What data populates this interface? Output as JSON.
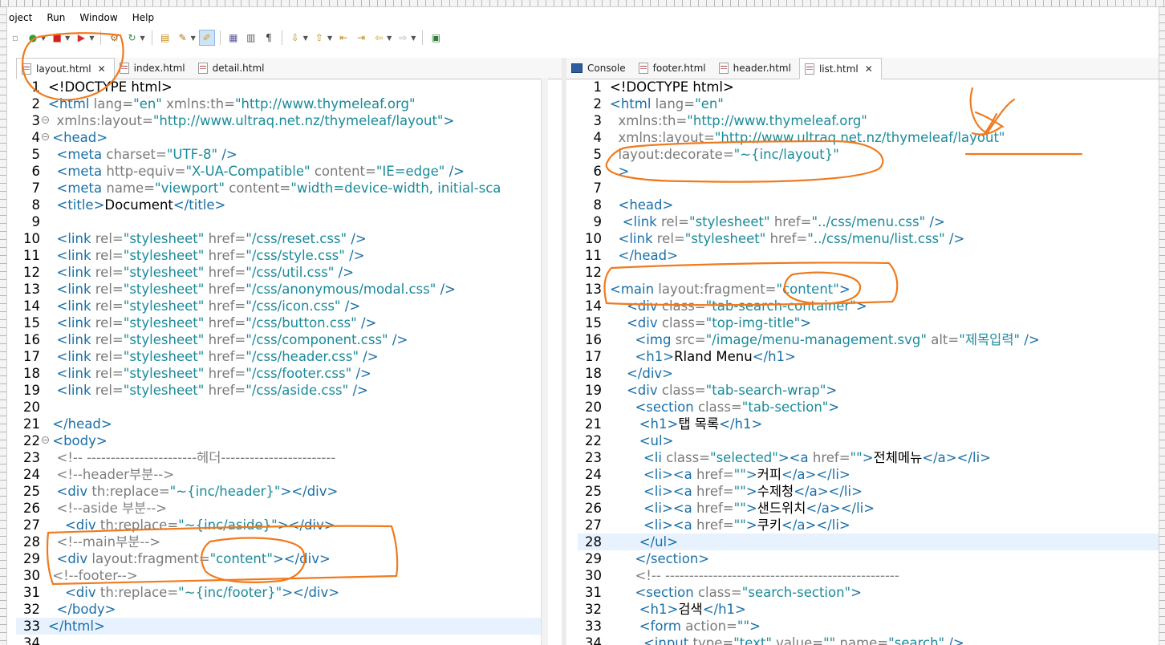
{
  "menu": [
    "oject",
    "Run",
    "Window",
    "Help"
  ],
  "toolbar_icons": [
    "new-icon",
    "run-icon",
    "stop-icon",
    "debug-icon",
    "build-icon",
    "refresh-icon",
    "open-icon",
    "tools-icon",
    "highlight-icon",
    "outline-icon",
    "properties-icon",
    "pilcrow-icon",
    "next-annotation-icon",
    "prev-annotation-icon",
    "forward-icon",
    "back-icon",
    "navigate-back-icon",
    "navigate-forward-icon",
    "maximize-icon"
  ],
  "left_tabs": [
    {
      "label": "layout.html",
      "active": true,
      "close": "✕"
    },
    {
      "label": "index.html",
      "active": false
    },
    {
      "label": "detail.html",
      "active": false
    }
  ],
  "right_tabs": [
    {
      "label": "Console",
      "active": false
    },
    {
      "label": "footer.html",
      "active": false
    },
    {
      "label": "header.html",
      "active": false
    },
    {
      "label": "list.html",
      "active": true,
      "close": "✕"
    }
  ],
  "left_code": [
    {
      "n": "1",
      "s": [
        [
          "t-doc",
          "<!DOCTYPE html>"
        ]
      ]
    },
    {
      "n": "2",
      "s": [
        [
          "t-tag",
          "<html "
        ],
        [
          "t-attr",
          "lang="
        ],
        [
          "t-str",
          "\"en\" "
        ],
        [
          "t-attr",
          "xmlns:th="
        ],
        [
          "t-str",
          "\"http://www.thymeleaf.org\""
        ]
      ]
    },
    {
      "n": "3",
      "f": "−",
      "s": [
        [
          "t-attr",
          "  xmlns:layout="
        ],
        [
          "t-str",
          "\"http://www.ultraq.net.nz/thymeleaf/layout\""
        ],
        [
          "t-tag",
          ">"
        ]
      ]
    },
    {
      "n": "4",
      "f": "−",
      "s": [
        [
          "t-tag",
          " <head>"
        ]
      ]
    },
    {
      "n": "5",
      "s": [
        [
          "t-tag",
          "  <meta "
        ],
        [
          "t-attr",
          "charset="
        ],
        [
          "t-str",
          "\"UTF-8\" "
        ],
        [
          "t-tag",
          "/>"
        ]
      ]
    },
    {
      "n": "6",
      "s": [
        [
          "t-tag",
          "  <meta "
        ],
        [
          "t-attr",
          "http-equiv="
        ],
        [
          "t-str",
          "\"X-UA-Compatible\" "
        ],
        [
          "t-attr",
          "content="
        ],
        [
          "t-str",
          "\"IE=edge\" "
        ],
        [
          "t-tag",
          "/>"
        ]
      ]
    },
    {
      "n": "7",
      "s": [
        [
          "t-tag",
          "  <meta "
        ],
        [
          "t-attr",
          "name="
        ],
        [
          "t-str",
          "\"viewport\" "
        ],
        [
          "t-attr",
          "content="
        ],
        [
          "t-str",
          "\"width=device-width, initial-sca"
        ]
      ]
    },
    {
      "n": "8",
      "s": [
        [
          "t-tag",
          "  <title>"
        ],
        [
          "t-doc",
          "Document"
        ],
        [
          "t-tag",
          "</title>"
        ]
      ]
    },
    {
      "n": "9",
      "s": []
    },
    {
      "n": "10",
      "s": [
        [
          "t-tag",
          "  <link "
        ],
        [
          "t-attr",
          "rel="
        ],
        [
          "t-str",
          "\"stylesheet\" "
        ],
        [
          "t-attr",
          "href="
        ],
        [
          "t-str",
          "\"/css/reset.css\" "
        ],
        [
          "t-tag",
          "/>"
        ]
      ]
    },
    {
      "n": "11",
      "s": [
        [
          "t-tag",
          "  <link "
        ],
        [
          "t-attr",
          "rel="
        ],
        [
          "t-str",
          "\"stylesheet\" "
        ],
        [
          "t-attr",
          "href="
        ],
        [
          "t-str",
          "\"/css/style.css\" "
        ],
        [
          "t-tag",
          "/>"
        ]
      ]
    },
    {
      "n": "12",
      "s": [
        [
          "t-tag",
          "  <link "
        ],
        [
          "t-attr",
          "rel="
        ],
        [
          "t-str",
          "\"stylesheet\" "
        ],
        [
          "t-attr",
          "href="
        ],
        [
          "t-str",
          "\"/css/util.css\" "
        ],
        [
          "t-tag",
          "/>"
        ]
      ]
    },
    {
      "n": "13",
      "s": [
        [
          "t-tag",
          "  <link "
        ],
        [
          "t-attr",
          "rel="
        ],
        [
          "t-str",
          "\"stylesheet\" "
        ],
        [
          "t-attr",
          "href="
        ],
        [
          "t-str",
          "\"/css/anonymous/modal.css\" "
        ],
        [
          "t-tag",
          "/>"
        ]
      ]
    },
    {
      "n": "14",
      "s": [
        [
          "t-tag",
          "  <link "
        ],
        [
          "t-attr",
          "rel="
        ],
        [
          "t-str",
          "\"stylesheet\" "
        ],
        [
          "t-attr",
          "href="
        ],
        [
          "t-str",
          "\"/css/icon.css\" "
        ],
        [
          "t-tag",
          "/>"
        ]
      ]
    },
    {
      "n": "15",
      "s": [
        [
          "t-tag",
          "  <link "
        ],
        [
          "t-attr",
          "rel="
        ],
        [
          "t-str",
          "\"stylesheet\" "
        ],
        [
          "t-attr",
          "href="
        ],
        [
          "t-str",
          "\"/css/button.css\" "
        ],
        [
          "t-tag",
          "/>"
        ]
      ]
    },
    {
      "n": "16",
      "s": [
        [
          "t-tag",
          "  <link "
        ],
        [
          "t-attr",
          "rel="
        ],
        [
          "t-str",
          "\"stylesheet\" "
        ],
        [
          "t-attr",
          "href="
        ],
        [
          "t-str",
          "\"/css/component.css\" "
        ],
        [
          "t-tag",
          "/>"
        ]
      ]
    },
    {
      "n": "17",
      "s": [
        [
          "t-tag",
          "  <link "
        ],
        [
          "t-attr",
          "rel="
        ],
        [
          "t-str",
          "\"stylesheet\" "
        ],
        [
          "t-attr",
          "href="
        ],
        [
          "t-str",
          "\"/css/header.css\" "
        ],
        [
          "t-tag",
          "/>"
        ]
      ]
    },
    {
      "n": "18",
      "s": [
        [
          "t-tag",
          "  <link "
        ],
        [
          "t-attr",
          "rel="
        ],
        [
          "t-str",
          "\"stylesheet\" "
        ],
        [
          "t-attr",
          "href="
        ],
        [
          "t-str",
          "\"/css/footer.css\" "
        ],
        [
          "t-tag",
          "/>"
        ]
      ]
    },
    {
      "n": "19",
      "s": [
        [
          "t-tag",
          "  <link "
        ],
        [
          "t-attr",
          "rel="
        ],
        [
          "t-str",
          "\"stylesheet\" "
        ],
        [
          "t-attr",
          "href="
        ],
        [
          "t-str",
          "\"/css/aside.css\" "
        ],
        [
          "t-tag",
          "/>"
        ]
      ]
    },
    {
      "n": "20",
      "s": []
    },
    {
      "n": "21",
      "s": [
        [
          "t-tag",
          " </head>"
        ]
      ]
    },
    {
      "n": "22",
      "f": "−",
      "s": [
        [
          "t-tag",
          " <body>"
        ]
      ]
    },
    {
      "n": "23",
      "s": [
        [
          "t-com",
          "  <!-- -----------------------헤더------------------------"
        ]
      ]
    },
    {
      "n": "24",
      "s": [
        [
          "t-com",
          "  <!--header부분-->"
        ]
      ]
    },
    {
      "n": "25",
      "s": [
        [
          "t-tag",
          "  <div "
        ],
        [
          "t-attr",
          "th:replace="
        ],
        [
          "t-str",
          "\"~{inc/header}\""
        ],
        [
          "t-tag",
          "></div>"
        ]
      ]
    },
    {
      "n": "26",
      "s": [
        [
          "t-com",
          "  <!--aside 부분-->"
        ]
      ]
    },
    {
      "n": "27",
      "s": [
        [
          "t-tag",
          "    <div "
        ],
        [
          "t-attr",
          "th:replace="
        ],
        [
          "t-str",
          "\"~{inc/aside}\""
        ],
        [
          "t-tag",
          "></div>"
        ]
      ]
    },
    {
      "n": "28",
      "s": [
        [
          "t-com",
          "  <!--main부분-->"
        ]
      ]
    },
    {
      "n": "29",
      "s": [
        [
          "t-tag",
          "  <div "
        ],
        [
          "t-attr",
          "layout:fragment="
        ],
        [
          "t-str",
          "\"content\""
        ],
        [
          "t-tag",
          "></div>"
        ]
      ]
    },
    {
      "n": "30",
      "s": [
        [
          "t-com",
          " <!--footer-->"
        ]
      ]
    },
    {
      "n": "31",
      "s": [
        [
          "t-tag",
          "    <div "
        ],
        [
          "t-attr",
          "th:replace="
        ],
        [
          "t-str",
          "\"~{inc/footer}\""
        ],
        [
          "t-tag",
          "></div>"
        ]
      ]
    },
    {
      "n": "32",
      "s": [
        [
          "t-tag",
          "  </body>"
        ]
      ]
    },
    {
      "n": "33",
      "hl": true,
      "s": [
        [
          "t-tag",
          "</html>"
        ]
      ]
    },
    {
      "n": "34",
      "s": []
    }
  ],
  "right_code": [
    {
      "n": "1",
      "s": [
        [
          "t-doc",
          "<!DOCTYPE html>"
        ]
      ]
    },
    {
      "n": "2",
      "s": [
        [
          "t-tag",
          "<html "
        ],
        [
          "t-attr",
          "lang="
        ],
        [
          "t-str",
          "\"en\""
        ]
      ]
    },
    {
      "n": "3",
      "s": [
        [
          "t-attr",
          "  xmlns:th="
        ],
        [
          "t-str",
          "\"http://www.thymeleaf.org\""
        ]
      ]
    },
    {
      "n": "4",
      "s": [
        [
          "t-attr",
          "  xmlns:layout="
        ],
        [
          "t-str",
          "\"http://www.ultraq.net.nz/thymeleaf/layout\""
        ]
      ]
    },
    {
      "n": "5",
      "s": [
        [
          "t-attr",
          "  layout:decorate="
        ],
        [
          "t-str",
          "\"~{inc/layout}\""
        ]
      ]
    },
    {
      "n": "6",
      "s": [
        [
          "t-tag",
          "  >"
        ]
      ]
    },
    {
      "n": "7",
      "s": []
    },
    {
      "n": "8",
      "s": [
        [
          "t-tag",
          "  <head>"
        ]
      ]
    },
    {
      "n": "9",
      "s": [
        [
          "t-tag",
          "   <link "
        ],
        [
          "t-attr",
          "rel="
        ],
        [
          "t-str",
          "\"stylesheet\" "
        ],
        [
          "t-attr",
          "href="
        ],
        [
          "t-str",
          "\"../css/menu.css\" "
        ],
        [
          "t-tag",
          "/>"
        ]
      ]
    },
    {
      "n": "10",
      "s": [
        [
          "t-tag",
          "  <link "
        ],
        [
          "t-attr",
          "rel="
        ],
        [
          "t-str",
          "\"stylesheet\" "
        ],
        [
          "t-attr",
          "href="
        ],
        [
          "t-str",
          "\"../css/menu/list.css\" "
        ],
        [
          "t-tag",
          "/>"
        ]
      ]
    },
    {
      "n": "11",
      "s": [
        [
          "t-tag",
          "  </head>"
        ]
      ]
    },
    {
      "n": "12",
      "s": []
    },
    {
      "n": "13",
      "s": [
        [
          "t-tag",
          "<main "
        ],
        [
          "t-attr",
          "layout:fragment="
        ],
        [
          "t-str",
          "\"content\""
        ],
        [
          "t-tag",
          ">"
        ]
      ]
    },
    {
      "n": "14",
      "s": [
        [
          "t-tag",
          "    <div "
        ],
        [
          "t-attr",
          "class="
        ],
        [
          "t-str",
          "\"tab-search-container\""
        ],
        [
          "t-tag",
          ">"
        ]
      ]
    },
    {
      "n": "15",
      "s": [
        [
          "t-tag",
          "    <div "
        ],
        [
          "t-attr",
          "class="
        ],
        [
          "t-str",
          "\"top-img-title\""
        ],
        [
          "t-tag",
          ">"
        ]
      ]
    },
    {
      "n": "16",
      "s": [
        [
          "t-tag",
          "      <img "
        ],
        [
          "t-attr",
          "src="
        ],
        [
          "t-str",
          "\"/image/menu-management.svg\" "
        ],
        [
          "t-attr",
          "alt="
        ],
        [
          "t-str",
          "\"제목입력\" "
        ],
        [
          "t-tag",
          "/>"
        ]
      ]
    },
    {
      "n": "17",
      "s": [
        [
          "t-tag",
          "      <h1>"
        ],
        [
          "t-doc",
          "Rland Menu"
        ],
        [
          "t-tag",
          "</h1>"
        ]
      ]
    },
    {
      "n": "18",
      "s": [
        [
          "t-tag",
          "    </div>"
        ]
      ]
    },
    {
      "n": "19",
      "s": [
        [
          "t-tag",
          "    <div "
        ],
        [
          "t-attr",
          "class="
        ],
        [
          "t-str",
          "\"tab-search-wrap\""
        ],
        [
          "t-tag",
          ">"
        ]
      ]
    },
    {
      "n": "20",
      "s": [
        [
          "t-tag",
          "      <section "
        ],
        [
          "t-attr",
          "class="
        ],
        [
          "t-str",
          "\"tab-section\""
        ],
        [
          "t-tag",
          ">"
        ]
      ]
    },
    {
      "n": "21",
      "s": [
        [
          "t-tag",
          "       <h1>"
        ],
        [
          "t-doc",
          "탭 목록"
        ],
        [
          "t-tag",
          "</h1>"
        ]
      ]
    },
    {
      "n": "22",
      "s": [
        [
          "t-tag",
          "       <ul>"
        ]
      ]
    },
    {
      "n": "23",
      "s": [
        [
          "t-tag",
          "        <li "
        ],
        [
          "t-attr",
          "class="
        ],
        [
          "t-str",
          "\"selected\""
        ],
        [
          "t-tag",
          "><a "
        ],
        [
          "t-attr",
          "href="
        ],
        [
          "t-str",
          "\"\""
        ],
        [
          "t-tag",
          ">"
        ],
        [
          "t-doc",
          "전체메뉴"
        ],
        [
          "t-tag",
          "</a></li>"
        ]
      ]
    },
    {
      "n": "24",
      "s": [
        [
          "t-tag",
          "        <li><a "
        ],
        [
          "t-attr",
          "href="
        ],
        [
          "t-str",
          "\"\""
        ],
        [
          "t-tag",
          ">"
        ],
        [
          "t-doc",
          "커피"
        ],
        [
          "t-tag",
          "</a></li>"
        ]
      ]
    },
    {
      "n": "25",
      "s": [
        [
          "t-tag",
          "        <li><a "
        ],
        [
          "t-attr",
          "href="
        ],
        [
          "t-str",
          "\"\""
        ],
        [
          "t-tag",
          ">"
        ],
        [
          "t-doc",
          "수제청"
        ],
        [
          "t-tag",
          "</a></li>"
        ]
      ]
    },
    {
      "n": "26",
      "s": [
        [
          "t-tag",
          "        <li><a "
        ],
        [
          "t-attr",
          "href="
        ],
        [
          "t-str",
          "\"\""
        ],
        [
          "t-tag",
          ">"
        ],
        [
          "t-doc",
          "샌드위치"
        ],
        [
          "t-tag",
          "</a></li>"
        ]
      ]
    },
    {
      "n": "27",
      "s": [
        [
          "t-tag",
          "        <li><a "
        ],
        [
          "t-attr",
          "href="
        ],
        [
          "t-str",
          "\"\""
        ],
        [
          "t-tag",
          ">"
        ],
        [
          "t-doc",
          "쿠키"
        ],
        [
          "t-tag",
          "</a></li>"
        ]
      ]
    },
    {
      "n": "28",
      "hl": true,
      "s": [
        [
          "t-tag",
          "       </ul>"
        ]
      ]
    },
    {
      "n": "29",
      "s": [
        [
          "t-tag",
          "      </section>"
        ]
      ]
    },
    {
      "n": "30",
      "s": [
        [
          "t-com",
          "      <!-- -------------------------------------------------"
        ]
      ]
    },
    {
      "n": "31",
      "s": [
        [
          "t-tag",
          "      <section "
        ],
        [
          "t-attr",
          "class="
        ],
        [
          "t-str",
          "\"search-section\""
        ],
        [
          "t-tag",
          ">"
        ]
      ]
    },
    {
      "n": "32",
      "s": [
        [
          "t-tag",
          "       <h1>"
        ],
        [
          "t-doc",
          "검색"
        ],
        [
          "t-tag",
          "</h1>"
        ]
      ]
    },
    {
      "n": "33",
      "s": [
        [
          "t-tag",
          "       <form "
        ],
        [
          "t-attr",
          "action="
        ],
        [
          "t-str",
          "\"\""
        ],
        [
          "t-tag",
          ">"
        ]
      ]
    },
    {
      "n": "34",
      "s": [
        [
          "t-tag",
          "        <input "
        ],
        [
          "t-attr",
          "type="
        ],
        [
          "t-str",
          "\"text\" "
        ],
        [
          "t-attr",
          "value="
        ],
        [
          "t-str",
          "\"\" "
        ],
        [
          "t-attr",
          "name="
        ],
        [
          "t-str",
          "\"search\" "
        ],
        [
          "t-tag",
          "/>"
        ]
      ]
    }
  ],
  "colors": {
    "tag": "#1a6fa8",
    "attr": "#7a7a7a",
    "string": "#1a8a9a",
    "comment": "#808080",
    "annotation": "#f07a1e",
    "current_line": "#e8f2fe"
  }
}
